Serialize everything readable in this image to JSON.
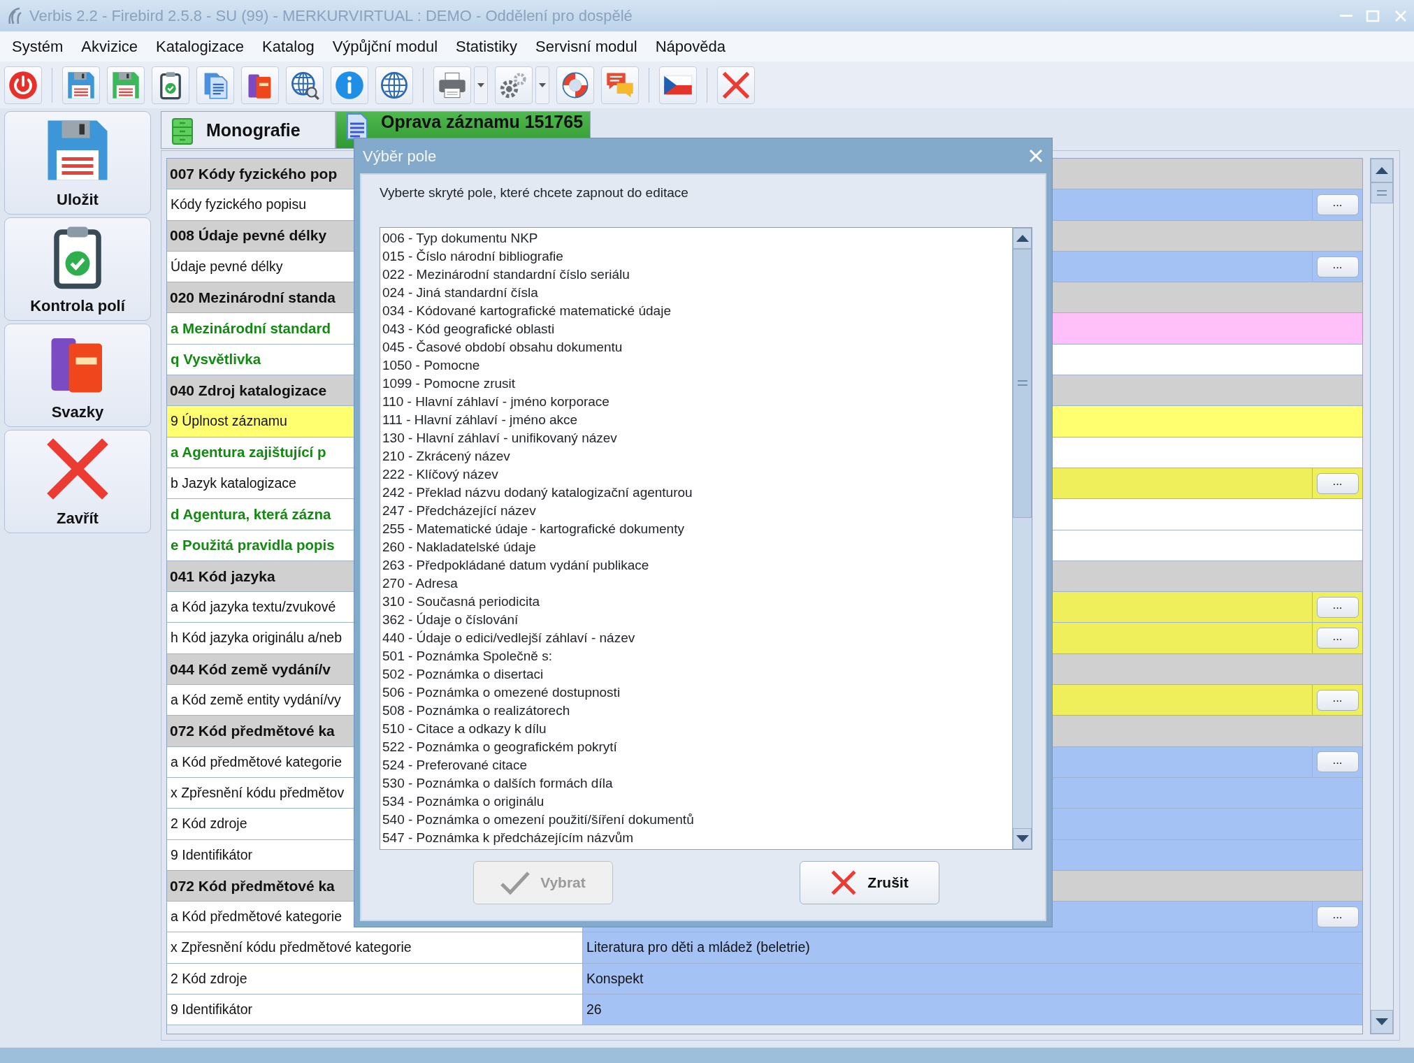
{
  "window": {
    "title": "Verbis 2.2 - Firebird 2.5.8 - SU (99) - MERKURVIRTUAL : DEMO - Oddělení pro dospělé"
  },
  "menu": [
    "Systém",
    "Akvizice",
    "Katalogizace",
    "Katalog",
    "Výpůjční modul",
    "Statistiky",
    "Servisní modul",
    "Nápověda"
  ],
  "sidebar": {
    "items": [
      {
        "kind": "save",
        "label": "Uložit"
      },
      {
        "kind": "check",
        "label": "Kontrola polí"
      },
      {
        "kind": "books",
        "label": "Svazky"
      },
      {
        "kind": "close",
        "label": "Zavřít"
      }
    ]
  },
  "tabs": [
    {
      "kind": "cabinet",
      "label": "Monografie",
      "selected": false
    },
    {
      "kind": "document",
      "label": "Oprava záznamu 151765",
      "selected": true
    }
  ],
  "rows": [
    {
      "kind": "header",
      "label": "007 Kódy fyzického pop"
    },
    {
      "kind": "subfield",
      "label": "Kódy fyzického popisu",
      "mandatory": false,
      "highlighted": false,
      "color": "#a4c2f4",
      "button": "..."
    },
    {
      "kind": "header",
      "label": "008 Údaje pevné délky"
    },
    {
      "kind": "subfield",
      "label": "Údaje pevné délky",
      "mandatory": false,
      "highlighted": false,
      "color": "#a4c2f4",
      "button": "..."
    },
    {
      "kind": "header",
      "label": "020 Mezinárodní standa"
    },
    {
      "kind": "subfield",
      "label": "a Mezinárodní standard",
      "mandatory": true,
      "highlighted": false,
      "color": "#ffbff9"
    },
    {
      "kind": "subfield",
      "label": "q Vysvětlivka",
      "mandatory": true,
      "highlighted": false,
      "color": "#ffffff"
    },
    {
      "kind": "header",
      "label": "040 Zdroj katalogizace"
    },
    {
      "kind": "subfield",
      "label": "9 Úplnost záznamu",
      "mandatory": false,
      "highlighted": true,
      "color": "#ffff70"
    },
    {
      "kind": "subfield",
      "label": "a Agentura zajištující p",
      "mandatory": true,
      "highlighted": false,
      "color": "#ffffff"
    },
    {
      "kind": "subfield",
      "label": "b Jazyk katalogizace",
      "mandatory": false,
      "highlighted": false,
      "color": "#efef5c",
      "button": "..."
    },
    {
      "kind": "subfield",
      "label": "d Agentura, která zázna",
      "mandatory": true,
      "highlighted": false,
      "color": "#ffffff"
    },
    {
      "kind": "subfield",
      "label": "e Použitá pravidla popis",
      "mandatory": true,
      "highlighted": false,
      "color": "#ffffff"
    },
    {
      "kind": "header",
      "label": "041 Kód jazyka"
    },
    {
      "kind": "subfield",
      "label": "a Kód jazyka textu/zvukové",
      "mandatory": false,
      "highlighted": false,
      "color": "#efef5c",
      "button": "..."
    },
    {
      "kind": "subfield",
      "label": "h Kód jazyka originálu a/neb",
      "mandatory": false,
      "highlighted": false,
      "color": "#efef5c",
      "button": "..."
    },
    {
      "kind": "header",
      "label": "044 Kód země vydání/v"
    },
    {
      "kind": "subfield",
      "label": "a Kód země entity vydání/vy",
      "mandatory": false,
      "highlighted": false,
      "color": "#efef5c",
      "button": "..."
    },
    {
      "kind": "header",
      "label": "072 Kód předmětové ka"
    },
    {
      "kind": "subfield",
      "label": "a Kód předmětové kategorie",
      "mandatory": false,
      "highlighted": false,
      "color": "#a4c2f4",
      "button": "..."
    },
    {
      "kind": "subfield",
      "label": "x Zpřesnění kódu předmětov",
      "mandatory": false,
      "highlighted": false,
      "color": "#a4c2f4"
    },
    {
      "kind": "subfield",
      "label": "2 Kód zdroje",
      "mandatory": false,
      "highlighted": false,
      "color": "#a4c2f4"
    },
    {
      "kind": "subfield",
      "label": "9 Identifikátor",
      "mandatory": false,
      "highlighted": false,
      "color": "#a4c2f4"
    },
    {
      "kind": "header",
      "label": "072 Kód předmětové ka"
    },
    {
      "kind": "subfield",
      "label": "a Kód předmětové kategorie",
      "mandatory": false,
      "highlighted": false,
      "color": "#a4c2f4",
      "button": "..."
    },
    {
      "kind": "subfield",
      "label": "x Zpřesnění kódu předmětové kategorie",
      "mandatory": false,
      "highlighted": false,
      "color": "#a4c2f4",
      "value": "Literatura pro děti a mládež (beletrie)"
    },
    {
      "kind": "subfield",
      "label": "2 Kód zdroje",
      "mandatory": false,
      "highlighted": false,
      "color": "#a4c2f4",
      "value": "Konspekt"
    },
    {
      "kind": "subfield",
      "label": "9 Identifikátor",
      "mandatory": false,
      "highlighted": false,
      "color": "#a4c2f4",
      "value": "26"
    }
  ],
  "dialog": {
    "title": "Výběr pole",
    "prompt": "Vyberte skryté pole, které chcete zapnout do editace",
    "items": [
      "006 - Typ dokumentu NKP",
      "015 - Číslo národní bibliografie",
      "022 - Mezinárodní standardní číslo seriálu",
      "024 - Jiná standardní čísla",
      "034 - Kódované kartografické matematické údaje",
      "043 - Kód geografické oblasti",
      "045 - Časové období obsahu dokumentu",
      "1050 - Pomocne",
      "1099 - Pomocne zrusit",
      "110 - Hlavní záhlaví - jméno korporace",
      "111 - Hlavní záhlaví - jméno akce",
      "130 - Hlavní záhlaví - unifikovaný název",
      "210 - Zkrácený název",
      "222 - Klíčový název",
      "242 - Překlad názvu dodaný katalogizační agenturou",
      "247 - Předcházející název",
      "255 - Matematické údaje - kartografické dokumenty",
      "260 - Nakladatelské údaje",
      "263 - Předpokládané datum vydání publikace",
      "270 - Adresa",
      "310 - Současná periodicita",
      "362 - Údaje o číslování",
      "440 - Údaje o edici/vedlejší záhlaví - název",
      "501 - Poznámka Společně s:",
      "502 - Poznámka o disertaci",
      "506 - Poznámka o omezené dostupnosti",
      "508 - Poznámka o realizátorech",
      "510 - Citace a odkazy k dílu",
      "522 - Poznámka o geografickém pokrytí",
      "524 - Preferované citace",
      "530 - Poznámka o dalších formách díla",
      "534 - Poznámka o originálu",
      "540 - Poznámka o omezení použití/šíření dokumentů",
      "547 - Poznámka k předcházejícím názvům"
    ],
    "buttons": [
      {
        "kind": "ok",
        "label": "Vybrat",
        "disabled": true
      },
      {
        "kind": "cancel",
        "label": "Zrušit",
        "disabled": false
      }
    ]
  }
}
